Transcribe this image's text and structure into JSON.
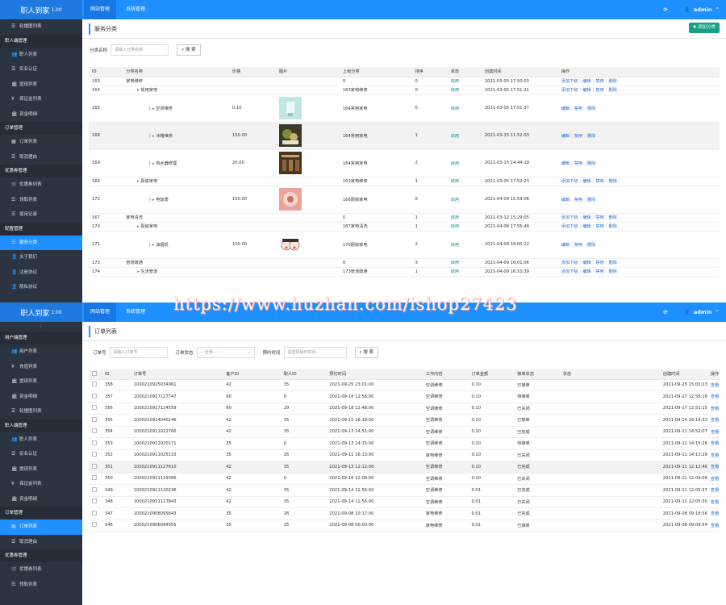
{
  "top1": {
    "logo": "职人到家",
    "ver": "1.00",
    "tabs": [
      "网站管理",
      "系统管理"
    ],
    "admin": "admin"
  },
  "side1": [
    {
      "t": "i",
      "label": "轮播图列表",
      "icon": "list-icon"
    },
    {
      "t": "g",
      "label": "职人端管理"
    },
    {
      "t": "i",
      "label": "职人列表",
      "icon": "users-icon"
    },
    {
      "t": "i",
      "label": "实名认证",
      "icon": "list-icon"
    },
    {
      "t": "i",
      "label": "提现列表",
      "icon": "bank-icon"
    },
    {
      "t": "i",
      "label": "保证金列表",
      "icon": "yen-icon"
    },
    {
      "t": "i",
      "label": "资金明细",
      "icon": "bank-icon"
    },
    {
      "t": "g",
      "label": "订单管理"
    },
    {
      "t": "i",
      "label": "订单列表",
      "icon": "table-icon"
    },
    {
      "t": "i",
      "label": "取消理由",
      "icon": "list-icon"
    },
    {
      "t": "g",
      "label": "优惠券管理"
    },
    {
      "t": "i",
      "label": "优惠券列表",
      "icon": "cart-icon"
    },
    {
      "t": "i",
      "label": "领取列表",
      "icon": "list-icon"
    },
    {
      "t": "i",
      "label": "使用记录",
      "icon": "list-icon"
    },
    {
      "t": "g",
      "label": "配置管理"
    },
    {
      "t": "i",
      "label": "服务分类",
      "icon": "list-icon",
      "on": true
    },
    {
      "t": "i",
      "label": "关于我们",
      "icon": "user-icon"
    },
    {
      "t": "i",
      "label": "注册协议",
      "icon": "user-icon"
    },
    {
      "t": "i",
      "label": "隐私协议",
      "icon": "user-icon"
    }
  ],
  "service": {
    "title": "服务分类",
    "add": "添加分类",
    "search_label": "分类名称",
    "placeholder": "请输入分类名称",
    "search_btn": "搜 索",
    "headers": [
      "ID",
      "分类名称",
      "价格",
      "图片",
      "上级分类",
      "排序",
      "状态",
      "创建时间",
      "操作"
    ],
    "rows": [
      {
        "id": "163",
        "name": "家电维修",
        "lvl": 0,
        "price": "",
        "img": "",
        "parent": "0",
        "sort": "0",
        "status": "启用",
        "time": "2021-03-05 17:50:03",
        "ops": [
          "添加下级",
          "编辑",
          "禁用",
          "删除"
        ]
      },
      {
        "id": "164",
        "name": "常用家电",
        "lvl": 1,
        "price": "",
        "img": "",
        "parent": "163家电维修",
        "sort": "0",
        "status": "启用",
        "time": "2021-03-05 17:51:21",
        "ops": [
          "添加下级",
          "编辑",
          "禁用",
          "删除"
        ]
      },
      {
        "id": "165",
        "name": "空调维修",
        "lvl": 2,
        "price": "0.10",
        "img": "ac",
        "parent": "164常用家电",
        "sort": "0",
        "status": "启用",
        "time": "2021-03-05 17:51:37",
        "ops": [
          "编辑",
          "禁用",
          "删除"
        ]
      },
      {
        "id": "168",
        "name": "冰箱维修",
        "lvl": 2,
        "price": "150.00",
        "img": "fridge",
        "parent": "164常用家电",
        "sort": "1",
        "status": "启用",
        "time": "2021-03-15 11:52:03",
        "ops": [
          "编辑",
          "禁用",
          "删除"
        ],
        "hl": true
      },
      {
        "id": "169",
        "name": "热水器修理",
        "lvl": 2,
        "price": "20.00",
        "img": "heater",
        "parent": "164常用家电",
        "sort": "2",
        "status": "启用",
        "time": "2021-03-15 14:44:19",
        "ops": [
          "编辑",
          "禁用",
          "删除"
        ]
      },
      {
        "id": "166",
        "name": "厨房家电",
        "lvl": 1,
        "price": "",
        "img": "",
        "parent": "163家电维修",
        "sort": "1",
        "status": "启用",
        "time": "2021-03-05 17:52:23",
        "ops": [
          "添加下级",
          "编辑",
          "禁用",
          "删除"
        ]
      },
      {
        "id": "172",
        "name": "电饭煲",
        "lvl": 2,
        "price": "150.00",
        "img": "cooker",
        "parent": "166厨房家电",
        "sort": "0",
        "status": "启用",
        "time": "2021-04-09 15:59:06",
        "ops": [
          "编辑",
          "禁用",
          "删除"
        ]
      },
      {
        "id": "167",
        "name": "家电清洗",
        "lvl": 0,
        "price": "",
        "img": "",
        "parent": "0",
        "sort": "1",
        "status": "启用",
        "time": "2021-03-12 15:29:05",
        "ops": [
          "添加下级",
          "编辑",
          "禁用",
          "删除"
        ]
      },
      {
        "id": "170",
        "name": "厨房家电",
        "lvl": 1,
        "price": "",
        "img": "",
        "parent": "167家电清洗",
        "sort": "1",
        "status": "启用",
        "time": "2021-04-08 17:55:48",
        "ops": [
          "添加下级",
          "编辑",
          "禁用",
          "删除"
        ]
      },
      {
        "id": "171",
        "name": "油烟机",
        "lvl": 2,
        "price": "150.00",
        "img": "cartoon",
        "parent": "170厨房家电",
        "sort": "2",
        "status": "启用",
        "time": "2021-04-08 18:00:22",
        "ops": [
          "编辑",
          "禁用",
          "删除"
        ]
      },
      {
        "id": "173",
        "name": "管道疏通",
        "lvl": 0,
        "price": "",
        "img": "",
        "parent": "0",
        "sort": "3",
        "status": "启用",
        "time": "2021-04-09 16:01:06",
        "ops": [
          "添加下级",
          "编辑",
          "禁用",
          "删除"
        ]
      },
      {
        "id": "174",
        "name": "生活管道",
        "lvl": 1,
        "price": "",
        "img": "",
        "parent": "173管道疏通",
        "sort": "1",
        "status": "启用",
        "time": "2021-04-09 16:10:39",
        "ops": [
          "添加下级",
          "编辑",
          "禁用",
          "删除"
        ]
      }
    ]
  },
  "top2": {
    "logo": "职人到家",
    "ver": "1.00",
    "tabs": [
      "网站管理",
      "系统管理"
    ],
    "admin": "admin"
  },
  "side2": [
    {
      "t": "g",
      "label": "用户端管理"
    },
    {
      "t": "i",
      "label": "用户列表",
      "icon": "users-icon"
    },
    {
      "t": "i",
      "label": "充值列表",
      "icon": "yen-icon"
    },
    {
      "t": "i",
      "label": "提现列表",
      "icon": "bank-icon"
    },
    {
      "t": "i",
      "label": "资金明细",
      "icon": "bank-icon"
    },
    {
      "t": "i",
      "label": "轮播图列表",
      "icon": "list-icon"
    },
    {
      "t": "g",
      "label": "职人端管理"
    },
    {
      "t": "i",
      "label": "职人列表",
      "icon": "users-icon"
    },
    {
      "t": "i",
      "label": "实名认证",
      "icon": "list-icon"
    },
    {
      "t": "i",
      "label": "提现列表",
      "icon": "bank-icon"
    },
    {
      "t": "i",
      "label": "保证金列表",
      "icon": "yen-icon"
    },
    {
      "t": "i",
      "label": "资金明细",
      "icon": "bank-icon"
    },
    {
      "t": "g",
      "label": "订单管理"
    },
    {
      "t": "i",
      "label": "订单列表",
      "icon": "table-icon",
      "on": true
    },
    {
      "t": "i",
      "label": "取消理由",
      "icon": "list-icon"
    },
    {
      "t": "g",
      "label": "优惠券管理"
    },
    {
      "t": "i",
      "label": "优惠券列表",
      "icon": "cart-icon"
    },
    {
      "t": "i",
      "label": "领取列表",
      "icon": "list-icon"
    }
  ],
  "orders": {
    "title": "订单列表",
    "f1_label": "订单号",
    "f1_ph": "请输入订单号",
    "f2_label": "订单状态",
    "f2_val": "-- 全部 --",
    "f3_label": "预约时间",
    "f3_ph": "请选择操作时间",
    "search_btn": "搜 索",
    "headers": [
      "ID",
      "订单号",
      "客户ID",
      "职人ID",
      "预约时间",
      "工作内容",
      "订单金额",
      "接单状态",
      "状态",
      "创建时间",
      "操作"
    ],
    "rows": [
      [
        "358",
        "1000210925034061",
        "42",
        "35",
        "2021-09-25 23:01:00",
        "空调维修",
        "0.10",
        "已接单",
        "2021-09-25 15:01:23",
        "查看"
      ],
      [
        "357",
        "1000210917127747",
        "60",
        "0",
        "2021-09-18 12:56:00",
        "空调维修",
        "0.10",
        "待接单",
        "2021-09-17 12:56:18",
        "查看"
      ],
      [
        "356",
        "1000210917124559",
        "60",
        "29",
        "2021-09-18 12:48:00",
        "空调维修",
        "0.10",
        "已关闭",
        "2021-09-17 12:51:15",
        "查看"
      ],
      [
        "355",
        "1000210914040146",
        "42",
        "35",
        "2021-09-15 16:19:00",
        "空调维修",
        "0.10",
        "已接单",
        "2021-09-14 16:19:33",
        "查看"
      ],
      [
        "354",
        "1000210911022766",
        "42",
        "35",
        "2021-09-13 14:51:00",
        "空调维修",
        "0.10",
        "已完成",
        "2021-09-11 14:52:07",
        "查看"
      ],
      [
        "353",
        "1000210911020171",
        "35",
        "0",
        "2021-09-13 14:15:00",
        "空调维修",
        "0.10",
        "待接单",
        "2021-09-11 14:15:26",
        "查看"
      ],
      [
        "352",
        "1000210911025133",
        "35",
        "26",
        "2021-09-11 16:13:00",
        "家电维修",
        "0.10",
        "已关闭",
        "2021-09-11 14:13:28",
        "查看"
      ],
      [
        "351",
        "1000210911127610",
        "42",
        "35",
        "2021-09-13 12:12:00",
        "空调维修",
        "0.10",
        "已完成",
        "2021-09-11 12:12:46",
        "查看"
      ],
      [
        "350",
        "1000210911129386",
        "42",
        "0",
        "2021-09-16 12:08:00",
        "空调维修",
        "0.10",
        "已关闭",
        "2021-09-11 12:09:08",
        "查看"
      ],
      [
        "349",
        "1000210911120236",
        "42",
        "35",
        "2021-09-14 11:56:00",
        "空调维修",
        "0.01",
        "已完成",
        "2021-09-11 12:05:37",
        "查看"
      ],
      [
        "348",
        "1000210911127843",
        "42",
        "35",
        "2021-09-14 11:56:00",
        "空调维修",
        "0.01",
        "已关闭",
        "2021-09-11 12:05:30",
        "查看"
      ],
      [
        "347",
        "1000210908095843",
        "35",
        "26",
        "2021-09-08 10:17:00",
        "家电维修",
        "0.01",
        "已完成",
        "2021-09-08 09:18:56",
        "查看"
      ],
      [
        "346",
        "1000210908094955",
        "35",
        "25",
        "2021-09-08 00:00:00",
        "家电维修",
        "0.01",
        "已接单",
        "2021-09-08 09:09:54",
        "查看"
      ]
    ]
  },
  "watermark": "https://www.huzhan.com/ishop27423"
}
